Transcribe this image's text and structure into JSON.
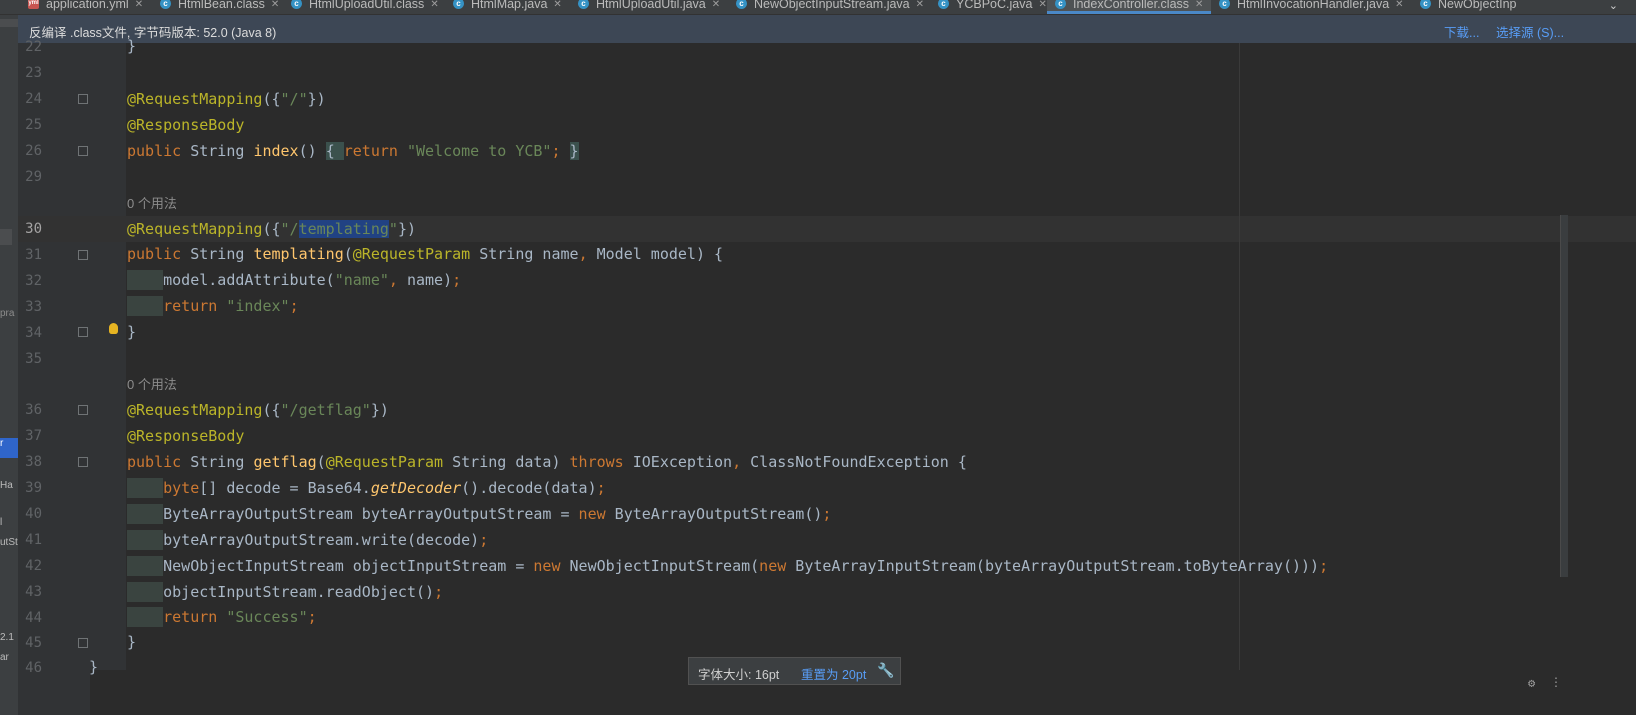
{
  "tabs": [
    {
      "label": "application.yml",
      "icon": "yml-file-icon"
    },
    {
      "label": "HtmlBean.class",
      "icon": "class-file-icon"
    },
    {
      "label": "HtmlUploadUtil.class",
      "icon": "class-file-icon"
    },
    {
      "label": "HtmlMap.java",
      "icon": "java-file-icon"
    },
    {
      "label": "HtmlUploadUtil.java",
      "icon": "java-file-icon"
    },
    {
      "label": "NewObjectInputStream.java",
      "icon": "java-file-icon"
    },
    {
      "label": "YCBPoC.java",
      "icon": "java-file-icon"
    },
    {
      "label": "IndexController.class",
      "icon": "class-file-icon",
      "active": true
    },
    {
      "label": "HtmlInvocationHandler.java",
      "icon": "java-file-icon"
    },
    {
      "label": "NewObjectInp",
      "icon": "java-file-icon"
    }
  ],
  "banner": {
    "message": "反编译 .class文件, 字节码版本: 52.0 (Java 8)",
    "download": "下载...",
    "choose_source": "选择源 (S)..."
  },
  "left_strip": [
    "pra",
    "r",
    "Ha",
    "l",
    "utSt",
    "2.1",
    "ar"
  ],
  "usage_hint": "0 个用法",
  "lines": [
    {
      "num": "22",
      "text": "}"
    },
    {
      "num": "23",
      "text": ""
    },
    {
      "num": "24",
      "text": "@RequestMapping({\"/\"})"
    },
    {
      "num": "25",
      "text": "@ResponseBody"
    },
    {
      "num": "26",
      "text": "public String index() { return \"Welcome to YCB\"; }"
    },
    {
      "num": "29",
      "text": ""
    },
    {
      "num": "30",
      "text": "@RequestMapping({\"/templating\"})"
    },
    {
      "num": "31",
      "text": "public String templating(@RequestParam String name, Model model) {"
    },
    {
      "num": "32",
      "text": "model.addAttribute(\"name\", name);"
    },
    {
      "num": "33",
      "text": "return \"index\";"
    },
    {
      "num": "34",
      "text": "}"
    },
    {
      "num": "35",
      "text": ""
    },
    {
      "num": "36",
      "text": "@RequestMapping({\"/getflag\"})"
    },
    {
      "num": "37",
      "text": "@ResponseBody"
    },
    {
      "num": "38",
      "text": "public String getflag(@RequestParam String data) throws IOException, ClassNotFoundException {"
    },
    {
      "num": "39",
      "text": "byte[] decode = Base64.getDecoder().decode(data);"
    },
    {
      "num": "40",
      "text": "ByteArrayOutputStream byteArrayOutputStream = new ByteArrayOutputStream();"
    },
    {
      "num": "41",
      "text": "byteArrayOutputStream.write(decode);"
    },
    {
      "num": "42",
      "text": "NewObjectInputStream objectInputStream = new NewObjectInputStream(new ByteArrayInputStream(byteArrayOutputStream.toByteArray()));"
    },
    {
      "num": "43",
      "text": "objectInputStream.readObject();"
    },
    {
      "num": "44",
      "text": "return \"Success\";"
    },
    {
      "num": "45",
      "text": "}"
    },
    {
      "num": "46",
      "text": "}"
    }
  ],
  "font_popup": {
    "label": "字体大小: 16pt",
    "reset": "重置为 20pt"
  },
  "colors": {
    "background": "#2b2b2b",
    "keyword": "#cc7832",
    "string": "#6a8759",
    "annotation": "#bbb529",
    "method": "#ffc66d",
    "link": "#589df6",
    "selection": "#214283"
  }
}
